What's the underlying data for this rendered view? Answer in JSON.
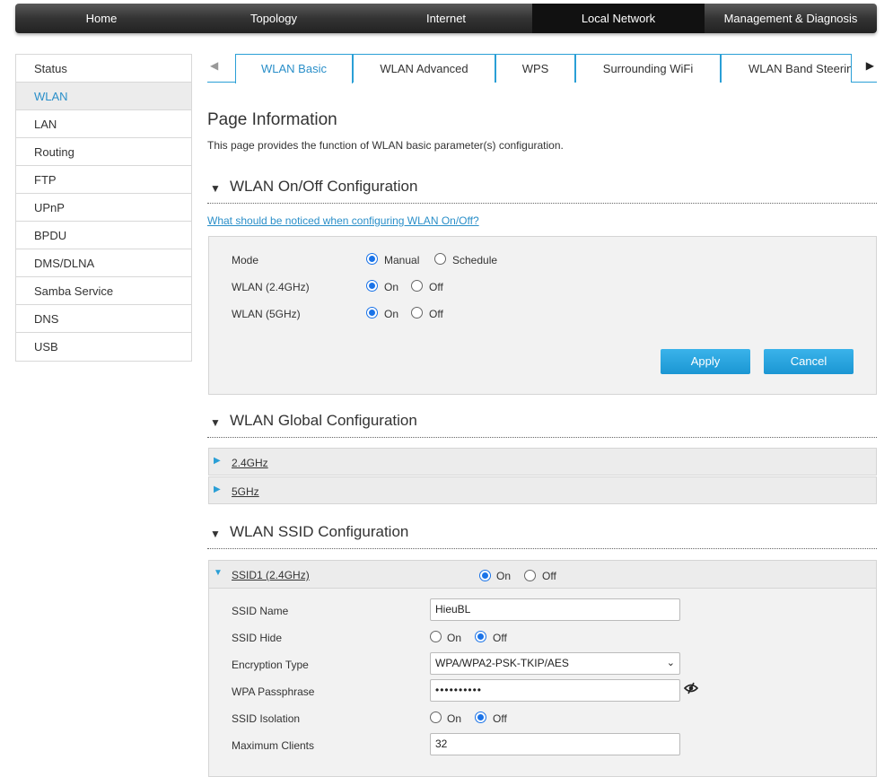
{
  "topnav": {
    "items": [
      "Home",
      "Topology",
      "Internet",
      "Local Network",
      "Management & Diagnosis"
    ],
    "active": "Local Network"
  },
  "sidebar": {
    "items": [
      "Status",
      "WLAN",
      "LAN",
      "Routing",
      "FTP",
      "UPnP",
      "BPDU",
      "DMS/DLNA",
      "Samba Service",
      "DNS",
      "USB"
    ],
    "active": "WLAN"
  },
  "tabs": {
    "items": [
      "WLAN Basic",
      "WLAN Advanced",
      "WPS",
      "Surrounding WiFi",
      "WLAN Band Steerin"
    ],
    "active": "WLAN Basic"
  },
  "page": {
    "title": "Page Information",
    "description": "This page provides the function of WLAN basic parameter(s) configuration."
  },
  "onoff": {
    "title": "WLAN On/Off Configuration",
    "help_link": "What should be noticed when configuring WLAN On/Off?",
    "mode_label": "Mode",
    "mode_manual": "Manual",
    "mode_schedule": "Schedule",
    "mode_value": "Manual",
    "wlan24_label": "WLAN (2.4GHz)",
    "wlan24_value": "On",
    "wlan5_label": "WLAN (5GHz)",
    "wlan5_value": "On",
    "on_label": "On",
    "off_label": "Off",
    "apply_label": "Apply",
    "cancel_label": "Cancel"
  },
  "global": {
    "title": "WLAN Global Configuration",
    "band24": "2.4GHz",
    "band5": "5GHz"
  },
  "ssid": {
    "title": "WLAN SSID Configuration",
    "header": "SSID1 (2.4GHz)",
    "enabled": "On",
    "on_label": "On",
    "off_label": "Off",
    "name_label": "SSID Name",
    "name_value": "HieuBL",
    "hide_label": "SSID Hide",
    "hide_value": "Off",
    "enc_label": "Encryption Type",
    "enc_value": "WPA/WPA2-PSK-TKIP/AES",
    "pass_label": "WPA Passphrase",
    "pass_value": "••••••••••",
    "iso_label": "SSID Isolation",
    "iso_value": "Off",
    "max_label": "Maximum Clients",
    "max_value": "32"
  },
  "colors": {
    "accent": "#2a9fd6",
    "link": "#2a8fc9",
    "button": "#1b96d3",
    "radio": "#1a73e8"
  }
}
